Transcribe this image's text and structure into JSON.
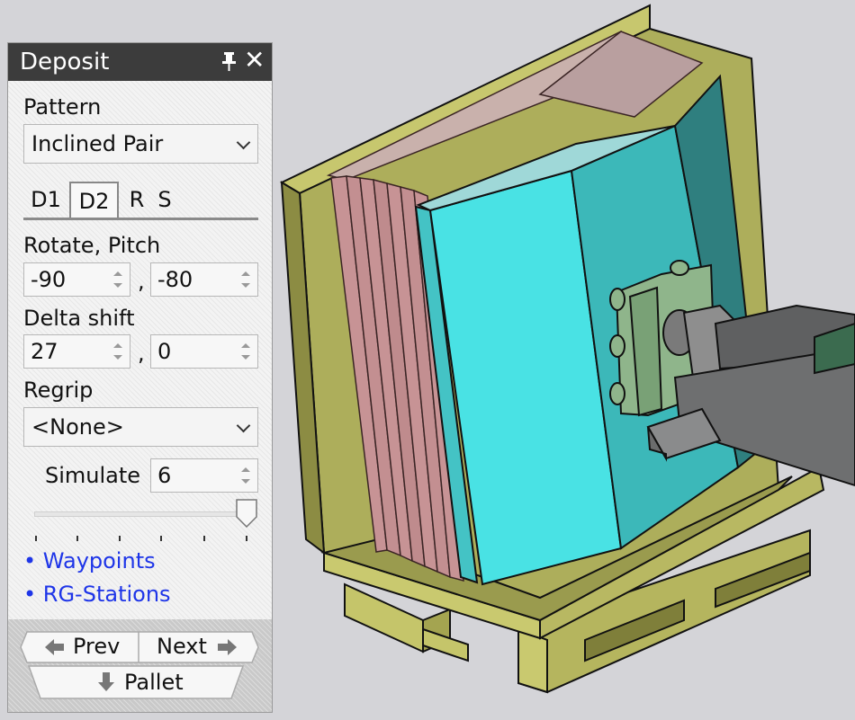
{
  "panel": {
    "title": "Deposit",
    "pattern_label": "Pattern",
    "pattern_value": "Inclined Pair",
    "tabs": [
      "D1",
      "D2",
      "R",
      "S"
    ],
    "active_tab": "D2",
    "rotate_pitch_label": "Rotate, Pitch",
    "rotate_value": "-90",
    "pitch_value": "-80",
    "delta_shift_label": "Delta shift",
    "delta_x_value": "27",
    "delta_y_value": "0",
    "separator": ",",
    "regrip_label": "Regrip",
    "regrip_value": "<None>",
    "simulate_label": "Simulate",
    "simulate_value": "6",
    "slider_level": 1.0,
    "links": [
      "• Waypoints",
      "• RG-Stations"
    ],
    "prev_label": "Prev",
    "next_label": "Next",
    "pallet_label": "Pallet"
  },
  "icons": {
    "pin": "pin-icon",
    "close": "close-icon",
    "prev": "arrow-left-icon",
    "next": "arrow-right-icon",
    "pallet": "arrow-down-icon"
  },
  "colors": {
    "titlebar": "#3c3c3c",
    "link": "#1e35e8",
    "viewport_bg": "#d4d4d8",
    "pallet": "#a9aa57",
    "box": "#49e2e4",
    "panels": "#c79395",
    "gripper": "#8fb58b",
    "robot": "#5f6061"
  }
}
